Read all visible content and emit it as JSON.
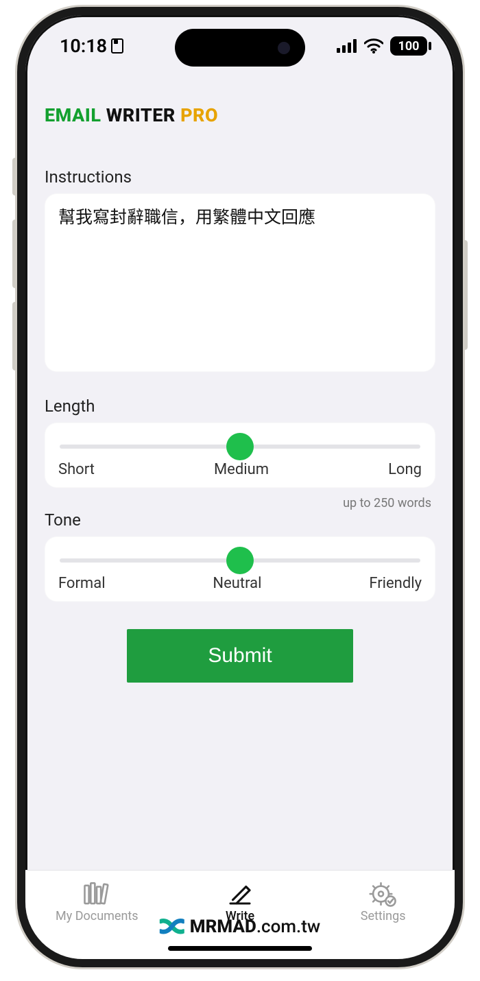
{
  "status": {
    "time": "10:18",
    "battery": "100"
  },
  "app": {
    "title_email": "EMAIL",
    "title_writer": "WRITER",
    "title_pro": "PRO"
  },
  "instructions": {
    "label": "Instructions",
    "value": "幫我寫封辭職信，用繁體中文回應"
  },
  "length": {
    "label": "Length",
    "min": "Short",
    "mid": "Medium",
    "max": "Long",
    "note": "up to 250 words",
    "value": 0.5
  },
  "tone": {
    "label": "Tone",
    "min": "Formal",
    "mid": "Neutral",
    "max": "Friendly",
    "value": 0.5
  },
  "submit_label": "Submit",
  "tabs": {
    "docs": "My Documents",
    "write": "Write",
    "settings": "Settings"
  },
  "watermark": {
    "bold": "MRMAD",
    "rest": ".com.tw"
  }
}
